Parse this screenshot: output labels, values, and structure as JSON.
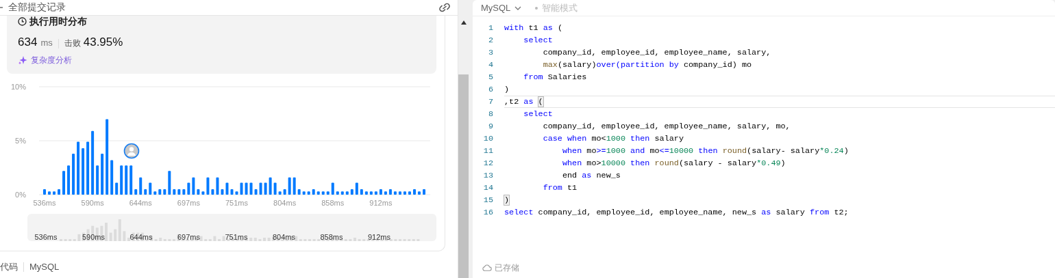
{
  "left_panel": {
    "header": {
      "title": "全部提交记录"
    },
    "runtime": {
      "title": "执行用时分布",
      "value": "634",
      "unit": "ms",
      "beat_label": "击败",
      "beat_value": "43.95%",
      "analysis_link": "复杂度分析"
    },
    "chart_data": {
      "type": "bar",
      "ylim": [
        0,
        10
      ],
      "yticks": [
        {
          "value": 0,
          "label": "0%"
        },
        {
          "value": 5,
          "label": "5%"
        },
        {
          "value": 10,
          "label": "10%"
        }
      ],
      "categories": [
        "536ms",
        null,
        null,
        null,
        null,
        null,
        null,
        null,
        null,
        null,
        "590ms",
        null,
        null,
        null,
        null,
        null,
        null,
        null,
        null,
        null,
        "644ms",
        null,
        null,
        null,
        null,
        null,
        null,
        null,
        null,
        null,
        "697ms",
        null,
        null,
        null,
        null,
        null,
        null,
        null,
        null,
        null,
        "751ms",
        null,
        null,
        null,
        null,
        null,
        null,
        null,
        null,
        null,
        "804ms",
        null,
        null,
        null,
        null,
        null,
        null,
        null,
        null,
        null,
        "858ms",
        null,
        null,
        null,
        null,
        null,
        null,
        null,
        null,
        null,
        "912ms",
        null,
        null,
        null,
        null,
        null,
        null,
        null,
        null,
        null
      ],
      "series": [
        {
          "color": "#007aff",
          "values": [
            0.5,
            0.3,
            0.3,
            0.5,
            2.2,
            2.7,
            3.8,
            4.9,
            4.3,
            4.9,
            5.9,
            2.7,
            3.8,
            7.0,
            3.2,
            1.1,
            2.7,
            2.7,
            2.7,
            0.5,
            1.6,
            0.5,
            1.1,
            0.3,
            0.5,
            0.5,
            2.2,
            0.5,
            0.5,
            0.5,
            1.1,
            1.6,
            0.5,
            0.3,
            1.6,
            0.5,
            1.6,
            0.5,
            1.1,
            0.5,
            0.3,
            1.1,
            1.1,
            1.1,
            0.5,
            1.1,
            1.1,
            1.6,
            1.1,
            0.3,
            0.5,
            1.6,
            1.6,
            0.5,
            0.3,
            0.3,
            0.5,
            0.3,
            0.3,
            0.3,
            1.1,
            0.3,
            0.3,
            0.3,
            0.5,
            1.1,
            0.5,
            0.3,
            0.3,
            0.3,
            0.5,
            0.3,
            0.5,
            0.3,
            0.3,
            0.3,
            0.3,
            0.5,
            0.3,
            0.5
          ]
        }
      ]
    },
    "overview": {
      "labels": [
        "536ms",
        "590ms",
        "644ms",
        "697ms",
        "751ms",
        "804ms",
        "858ms",
        "912ms"
      ]
    },
    "footer": {
      "tab": "代码",
      "language": "MySQL"
    }
  },
  "editor": {
    "language": "MySQL",
    "mode": "智能模式",
    "status": "已存储",
    "lines": [
      {
        "number": "1",
        "current": false,
        "tokens": [
          {
            "kind": "keyword",
            "t": "with"
          },
          {
            "kind": "plain",
            "t": " t1 "
          },
          {
            "kind": "keyword",
            "t": "as"
          },
          {
            "kind": "plain",
            "t": " ("
          }
        ]
      },
      {
        "number": "2",
        "current": false,
        "tokens": [
          {
            "kind": "keyword",
            "t": "    select"
          }
        ]
      },
      {
        "number": "3",
        "current": false,
        "tokens": [
          {
            "kind": "plain",
            "t": "        company_id, employee_id, employee_name, salary,"
          }
        ]
      },
      {
        "number": "4",
        "current": false,
        "tokens": [
          {
            "kind": "function",
            "t": "        max"
          },
          {
            "kind": "plain",
            "t": "(salary)"
          },
          {
            "kind": "keyword",
            "t": "over(partition by"
          },
          {
            "kind": "plain",
            "t": " company_id) mo"
          }
        ]
      },
      {
        "number": "5",
        "current": false,
        "tokens": [
          {
            "kind": "keyword",
            "t": "    from"
          },
          {
            "kind": "plain",
            "t": " Salaries"
          }
        ]
      },
      {
        "number": "6",
        "current": false,
        "tokens": [
          {
            "kind": "plain",
            "t": ")"
          }
        ]
      },
      {
        "number": "7",
        "current": true,
        "tokens": [
          {
            "kind": "plain",
            "t": ",t2 "
          },
          {
            "kind": "keyword",
            "t": "as"
          },
          {
            "kind": "bracket",
            "t": " ("
          }
        ]
      },
      {
        "number": "8",
        "current": false,
        "tokens": [
          {
            "kind": "keyword",
            "t": "    select"
          }
        ]
      },
      {
        "number": "9",
        "current": false,
        "tokens": [
          {
            "kind": "plain",
            "t": "        company_id, employee_id, employee_name, salary, mo,"
          }
        ]
      },
      {
        "number": "10",
        "current": false,
        "tokens": [
          {
            "kind": "keyword",
            "t": "        case when"
          },
          {
            "kind": "plain",
            "t": " mo<"
          },
          {
            "kind": "number",
            "t": "1000"
          },
          {
            "kind": "keyword",
            "t": " then"
          },
          {
            "kind": "plain",
            "t": " salary"
          }
        ]
      },
      {
        "number": "11",
        "current": false,
        "tokens": [
          {
            "kind": "keyword",
            "t": "            when"
          },
          {
            "kind": "plain",
            "t": " mo"
          },
          {
            "kind": "keyword",
            "t": ">="
          },
          {
            "kind": "number",
            "t": "1000"
          },
          {
            "kind": "keyword",
            "t": " and"
          },
          {
            "kind": "plain",
            "t": " mo"
          },
          {
            "kind": "keyword",
            "t": "<="
          },
          {
            "kind": "number",
            "t": "10000"
          },
          {
            "kind": "keyword",
            "t": " then"
          },
          {
            "kind": "function",
            "t": " round"
          },
          {
            "kind": "plain",
            "t": "(salary- salary"
          },
          {
            "kind": "number",
            "t": "*0.24"
          },
          {
            "kind": "plain",
            "t": ")"
          }
        ]
      },
      {
        "number": "12",
        "current": false,
        "tokens": [
          {
            "kind": "keyword",
            "t": "            when"
          },
          {
            "kind": "plain",
            "t": " mo>"
          },
          {
            "kind": "number",
            "t": "10000"
          },
          {
            "kind": "keyword",
            "t": " then"
          },
          {
            "kind": "function",
            "t": " round"
          },
          {
            "kind": "plain",
            "t": "(salary - salary"
          },
          {
            "kind": "number",
            "t": "*0.49"
          },
          {
            "kind": "plain",
            "t": ")"
          }
        ]
      },
      {
        "number": "13",
        "current": false,
        "tokens": [
          {
            "kind": "plain",
            "t": "            end "
          },
          {
            "kind": "keyword",
            "t": "as"
          },
          {
            "kind": "plain",
            "t": " new_s"
          }
        ]
      },
      {
        "number": "14",
        "current": false,
        "tokens": [
          {
            "kind": "keyword",
            "t": "        from"
          },
          {
            "kind": "plain",
            "t": " t1"
          }
        ]
      },
      {
        "number": "15",
        "current": false,
        "tokens": [
          {
            "kind": "bracket",
            "t": ")"
          }
        ]
      },
      {
        "number": "16",
        "current": false,
        "tokens": [
          {
            "kind": "keyword",
            "t": "select"
          },
          {
            "kind": "plain",
            "t": " company_id, employee_id, employee_name, new_s "
          },
          {
            "kind": "keyword",
            "t": "as"
          },
          {
            "kind": "plain",
            "t": " salary "
          },
          {
            "kind": "keyword",
            "t": "from"
          },
          {
            "kind": "plain",
            "t": " t2;"
          }
        ]
      }
    ]
  }
}
